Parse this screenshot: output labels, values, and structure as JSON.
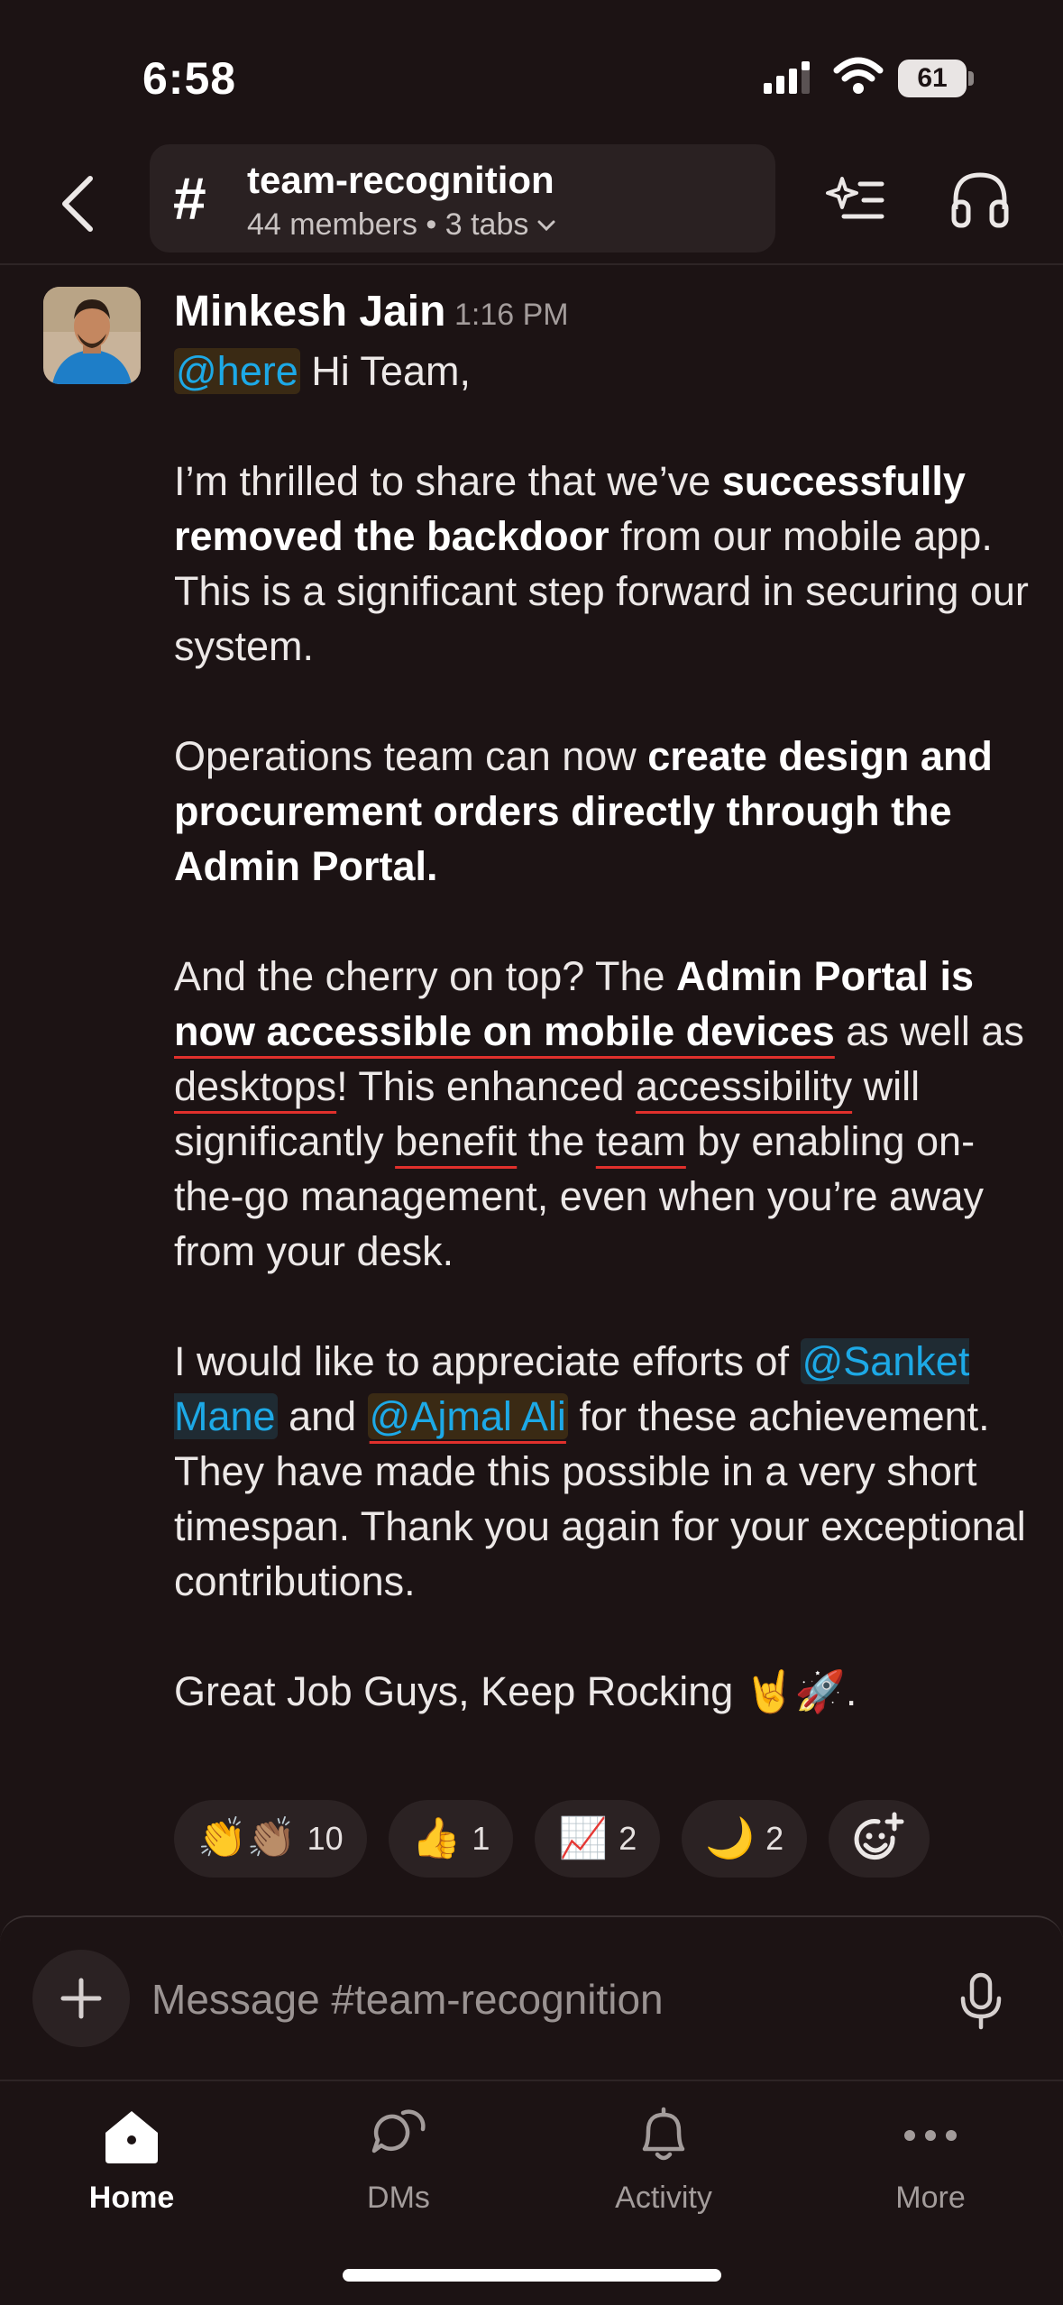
{
  "status_bar": {
    "time": "6:58",
    "battery": "61"
  },
  "header": {
    "channel_name": "team-recognition",
    "channel_meta": "44 members • 3 tabs",
    "hash_symbol": "#"
  },
  "message": {
    "author": "Minkesh Jain",
    "time": "1:16 PM",
    "mention_here": "@here",
    "greeting": " Hi Team,",
    "p1_a": "I’m thrilled to share that we’ve ",
    "p1_b": "successfully removed the backdoor",
    "p1_c": " from our mobile app. This is a significant step forward in securing our system.",
    "p2_a": "Operations team can now ",
    "p2_b": "create design and procurement orders directly through the Admin Portal.",
    "p3_a": "And the cherry on top? The ",
    "p3_b1": "Admin Portal is ",
    "p3_b2": "now accessible on mobile devices",
    "p3_c1": " as well as ",
    "p3_c2": "desktops",
    "p3_c3": "! This enhanced ",
    "p3_c4": "accessibility",
    "p3_c5": " will significantly ",
    "p3_c6": "benefit",
    "p3_c7": " the ",
    "p3_c8": "team",
    "p3_c9": " by enabling on-the-go management, even when you’re away from your desk.",
    "p4_a": "I would like to appreciate efforts of ",
    "mention_sanket": "@Sanket Mane",
    "p4_b": " and ",
    "mention_ajmal": "@Ajmal Ali",
    "p4_c": " for these achievement. They have made this possible in a very short timespan. Thank you again for your exceptional contributions.",
    "p5": "Great Job Guys, Keep Rocking 🤘🚀."
  },
  "reactions": [
    {
      "emoji": "👏👏🏽",
      "count": "10"
    },
    {
      "emoji": "👍",
      "count": "1"
    },
    {
      "emoji": "📈",
      "count": "2"
    },
    {
      "emoji": "🌙",
      "count": "2"
    }
  ],
  "composer": {
    "placeholder": "Message #team-recognition"
  },
  "tabbar": {
    "home": "Home",
    "dms": "DMs",
    "activity": "Activity",
    "more": "More"
  },
  "colors": {
    "background": "#1c1314",
    "mention": "#1da9e6",
    "spellcheck": "#e0302c"
  }
}
